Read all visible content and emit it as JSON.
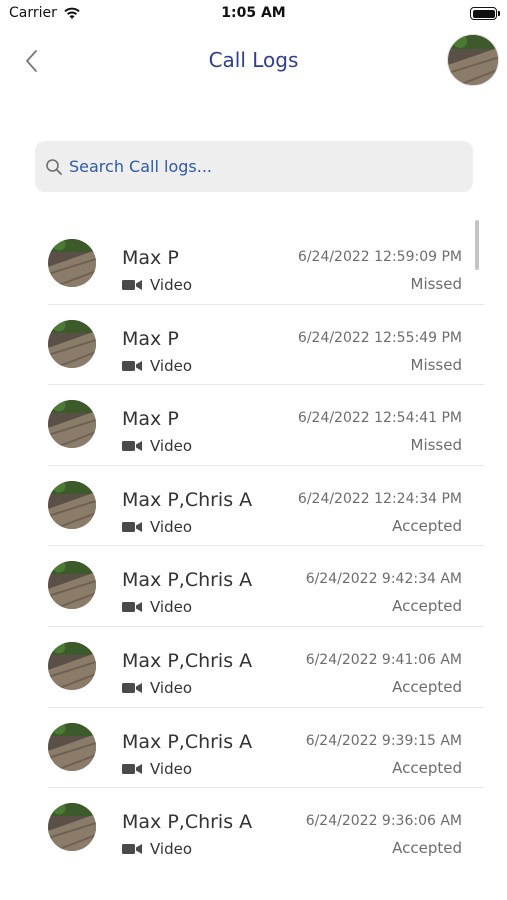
{
  "status_bar": {
    "carrier": "Carrier",
    "time": "1:05 AM"
  },
  "header": {
    "title": "Call Logs"
  },
  "search": {
    "placeholder": "Search Call logs..."
  },
  "calls": [
    {
      "name": "Max P",
      "type": "Video",
      "datetime": "6/24/2022 12:59:09 PM",
      "status": "Missed"
    },
    {
      "name": "Max P",
      "type": "Video",
      "datetime": "6/24/2022 12:55:49 PM",
      "status": "Missed"
    },
    {
      "name": "Max P",
      "type": "Video",
      "datetime": "6/24/2022 12:54:41 PM",
      "status": "Missed"
    },
    {
      "name": "Max P,Chris A",
      "type": "Video",
      "datetime": "6/24/2022 12:24:34 PM",
      "status": "Accepted"
    },
    {
      "name": "Max P,Chris A",
      "type": "Video",
      "datetime": "6/24/2022 9:42:34 AM",
      "status": "Accepted"
    },
    {
      "name": "Max P,Chris A",
      "type": "Video",
      "datetime": "6/24/2022 9:41:06 AM",
      "status": "Accepted"
    },
    {
      "name": "Max P,Chris A",
      "type": "Video",
      "datetime": "6/24/2022 9:39:15 AM",
      "status": "Accepted"
    },
    {
      "name": "Max P,Chris A",
      "type": "Video",
      "datetime": "6/24/2022 9:36:06 AM",
      "status": "Accepted"
    }
  ],
  "colors": {
    "accent": "#2d3f8e",
    "search_bg": "#eeeeee",
    "secondary_text": "#6d6d6d"
  },
  "icons": {
    "back": "chevron-left-icon",
    "search": "search-icon",
    "video": "video-camera-icon",
    "wifi": "wifi-icon",
    "battery": "battery-icon"
  }
}
